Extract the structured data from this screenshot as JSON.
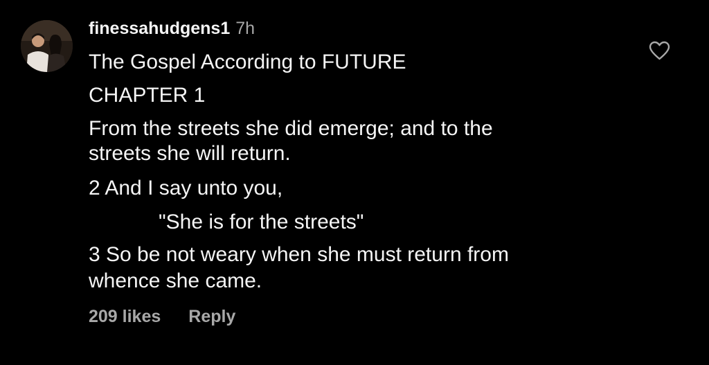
{
  "comment": {
    "username": "finessahudgens1",
    "timestamp": "7h",
    "lines": [
      "The Gospel According to FUTURE",
      "CHAPTER 1",
      "From the streets she did emerge; and to the",
      "streets she will return.",
      "2 And I say unto you,",
      "\"She is for the streets\"",
      "3 So be not weary when she must return from",
      "whence she came."
    ],
    "likes_label": "209 likes",
    "reply_label": "Reply",
    "like_icon": "heart-outline-icon"
  },
  "colors": {
    "background": "#000000",
    "primary_text": "#f5f5f5",
    "secondary_text": "#a8a8a8"
  }
}
